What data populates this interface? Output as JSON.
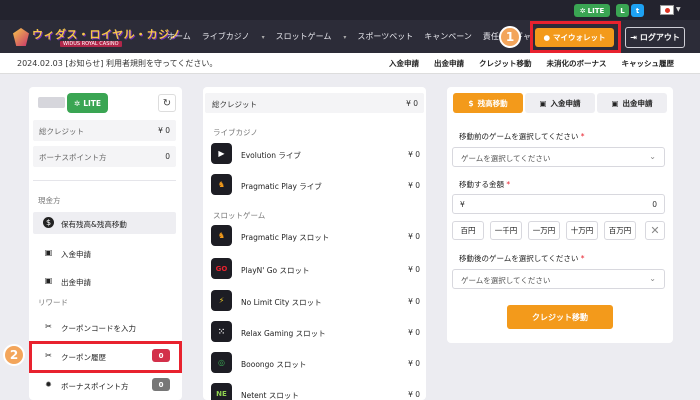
{
  "topbar": {
    "lite_label": "LITE",
    "language_flag": "japan-flag"
  },
  "brand": {
    "logo_text": "ウィダス・ロイヤル・カジノ",
    "logo_sub": "WIDUS ROYAL CASINO"
  },
  "nav": {
    "links": [
      "ホーム",
      "ライブカジノ",
      "スロットゲーム",
      "スポーツベット",
      "キャンペーン",
      "責任あるギャ"
    ],
    "wallet_label": "マイウォレット",
    "logout_label": "ログアウト"
  },
  "callouts": {
    "one": "1",
    "two": "2"
  },
  "subnav": {
    "notice": "2024.02.03 [お知らせ] 利用者規則を守ってください。",
    "links": [
      "入金申請",
      "出金申請",
      "クレジット移動",
      "未消化のボーナス",
      "キャッシュ履歴"
    ]
  },
  "left_panel": {
    "tier_label": "LITE",
    "total_credit_label": "総クレジット",
    "total_credit_value": "¥ 0",
    "bonus_points_label": "ボーナスポイント方",
    "bonus_points_value": "0",
    "section_cash": "現金方",
    "items_cash": [
      {
        "label": "保有残高&残高移動",
        "icon": "dollar-circle-icon"
      },
      {
        "label": "入金申請",
        "icon": "deposit-icon"
      },
      {
        "label": "出金申請",
        "icon": "withdraw-icon"
      }
    ],
    "section_reward": "リワード",
    "items_reward": [
      {
        "label": "クーポンコードを入力",
        "icon": "ticket-icon"
      },
      {
        "label": "クーポン履歴",
        "icon": "ticket-icon",
        "count": "0"
      },
      {
        "label": "ボーナスポイント方",
        "icon": "gear-icon",
        "count": "0"
      }
    ]
  },
  "middle_panel": {
    "total_credit_label": "総クレジット",
    "total_credit_value": "¥ 0",
    "section_live": "ライブカジノ",
    "section_slot": "スロットゲーム",
    "live_games": [
      {
        "name": "Evolution ライブ",
        "value": "¥ 0",
        "icon": "evolution-logo-icon"
      },
      {
        "name": "Pragmatic Play ライブ",
        "value": "¥ 0",
        "icon": "pragmatic-logo-icon"
      }
    ],
    "slot_games": [
      {
        "name": "Pragmatic Play スロット",
        "value": "¥ 0",
        "icon": "pragmatic-logo-icon"
      },
      {
        "name": "PlayN' Go スロット",
        "value": "¥ 0",
        "icon": "playngo-logo-icon"
      },
      {
        "name": "No Limit City スロット",
        "value": "¥ 0",
        "icon": "lightning-icon"
      },
      {
        "name": "Relax Gaming スロット",
        "value": "¥ 0",
        "icon": "dice-icon"
      },
      {
        "name": "Booongo スロット",
        "value": "¥ 0",
        "icon": "booongo-logo-icon"
      },
      {
        "name": "Netent スロット",
        "value": "¥ 0",
        "icon": "netent-logo-icon"
      }
    ]
  },
  "right_panel": {
    "tabs": [
      "残高移動",
      "入金申請",
      "出金申請"
    ],
    "from_label": "移動前のゲームを選択してください",
    "from_placeholder": "ゲームを選択してください",
    "amount_label": "移動する金額",
    "amount_currency": "¥",
    "amount_value": "0",
    "quick_amounts": [
      "百円",
      "一千円",
      "一万円",
      "十万円",
      "百万円"
    ],
    "to_label": "移動後のゲームを選択してください",
    "to_placeholder": "ゲームを選択してください",
    "required_mark": "*",
    "submit_label": "クレジット移動"
  },
  "colors": {
    "accent": "#f39a1b",
    "lite_green": "#3aa553",
    "highlight_red": "#e8222e",
    "nav_bg": "#2c2c38"
  }
}
